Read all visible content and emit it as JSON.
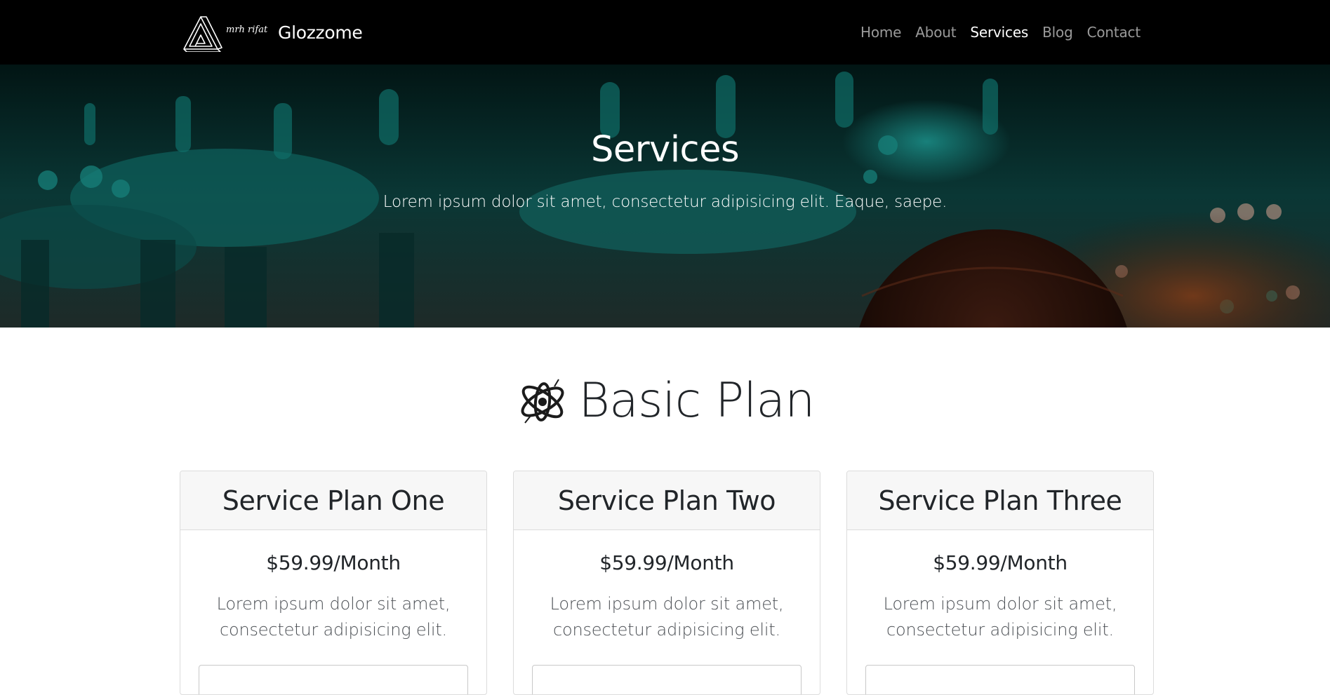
{
  "navbar": {
    "brand_logo_text": "mrh rifat",
    "brand_name": "Glozzome",
    "links": [
      {
        "label": "Home",
        "active": false
      },
      {
        "label": "About",
        "active": false
      },
      {
        "label": "Services",
        "active": true
      },
      {
        "label": "Blog",
        "active": false
      },
      {
        "label": "Contact",
        "active": false
      }
    ]
  },
  "hero": {
    "title": "Services",
    "subtitle": "Lorem ipsum dolor sit amet, consectetur adipisicing elit. Eaque, saepe."
  },
  "plan_section": {
    "heading": "Basic Plan",
    "icon": "atom-logo-icon"
  },
  "cards": [
    {
      "title": "Service Plan One",
      "price": "$59.99/Month",
      "text": "Lorem ipsum dolor sit amet, consectetur adipisicing elit."
    },
    {
      "title": "Service Plan Two",
      "price": "$59.99/Month",
      "text": "Lorem ipsum dolor sit amet, consectetur adipisicing elit."
    },
    {
      "title": "Service Plan Three",
      "price": "$59.99/Month",
      "text": "Lorem ipsum dolor sit amet, consectetur adipisicing elit."
    }
  ],
  "colors": {
    "navbar_bg": "#000000",
    "hero_tint": "#0b5a56",
    "card_header_bg": "#f7f7f7"
  }
}
